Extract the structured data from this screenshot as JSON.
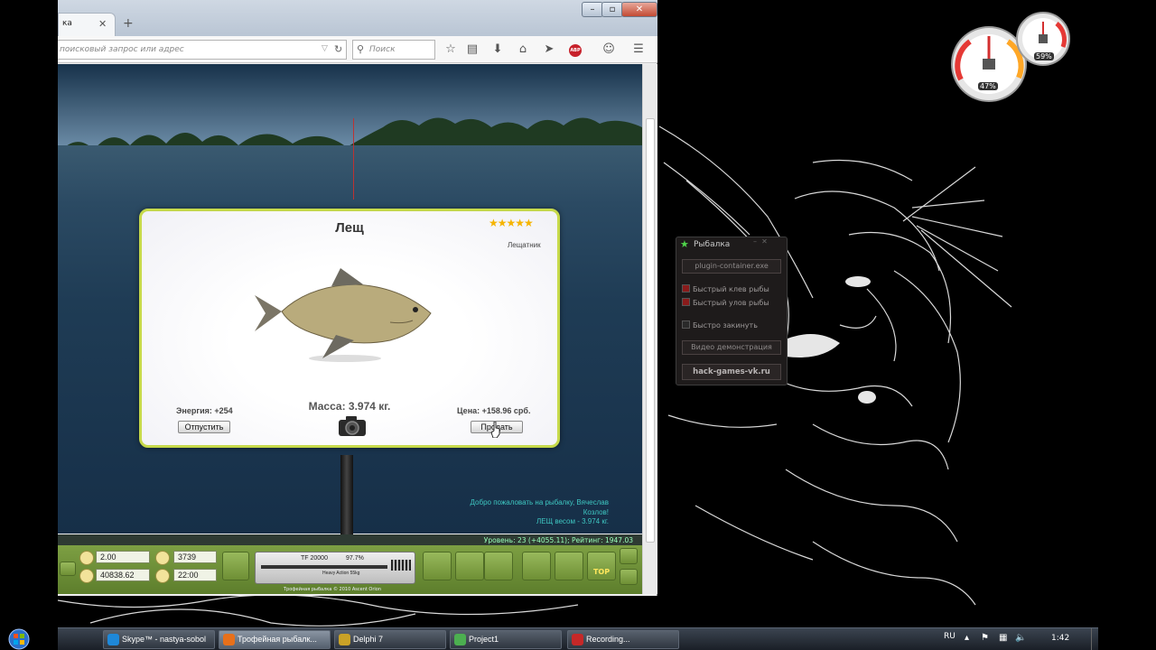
{
  "browser": {
    "tab_title": "ка",
    "url_placeholder": "поисковый запрос или адрес",
    "search_placeholder": "Поиск",
    "abp_label": "ABP"
  },
  "game": {
    "catch": {
      "fish_name": "Лещ",
      "stars": "★★★★★",
      "star_rating": 5,
      "subtype": "Лещатник",
      "energy": "Энергия: +254",
      "mass": "Масса: 3.974 кг.",
      "price": "Цена: +158.96 срб.",
      "release_label": "Отпустить",
      "sell_label": "Продать"
    },
    "messages": [
      "Добро пожаловать на рыбалку, Вячеслав",
      "Козлов!",
      "ЛЕЩ весом - 3.974 кг."
    ],
    "level_text": "Уровень: 23 (+4055.11); Рейтинг: 1947.03",
    "hud": {
      "field1": "2.00",
      "field2": "3739",
      "field3": "40838.62",
      "field4": "22:00",
      "rod_model": "TF 20000",
      "rod_percent": "97.7%",
      "rod_sub": "Heavy Action 55kg",
      "copyright": "Трофейная рыбалка © 2010 Ascent Orion",
      "top_label": "TOP"
    }
  },
  "cheat": {
    "title": "Рыбалка",
    "process": "plugin-container.exe",
    "options": [
      {
        "label": "Быстрый клев рыбы",
        "checked": true
      },
      {
        "label": "Быстрый улов рыбы",
        "checked": true
      },
      {
        "label": "Быстро закинуть",
        "checked": false
      }
    ],
    "demo_button": "Видео демонстрация",
    "site": "hack-games-vk.ru"
  },
  "gadgets": {
    "cpu_percent": "47%",
    "ram_percent": "59%"
  },
  "taskbar": {
    "items": [
      {
        "label": "Skype™ - nastya-sobol",
        "color": "#1e88d9"
      },
      {
        "label": "Трофейная рыбалк...",
        "color": "#e8701a"
      },
      {
        "label": "Delphi 7",
        "color": "#c9a227"
      },
      {
        "label": "Project1",
        "color": "#4caf50"
      },
      {
        "label": "Recording...",
        "color": "#c62828"
      }
    ],
    "lang": "RU",
    "clock": "1:42"
  }
}
